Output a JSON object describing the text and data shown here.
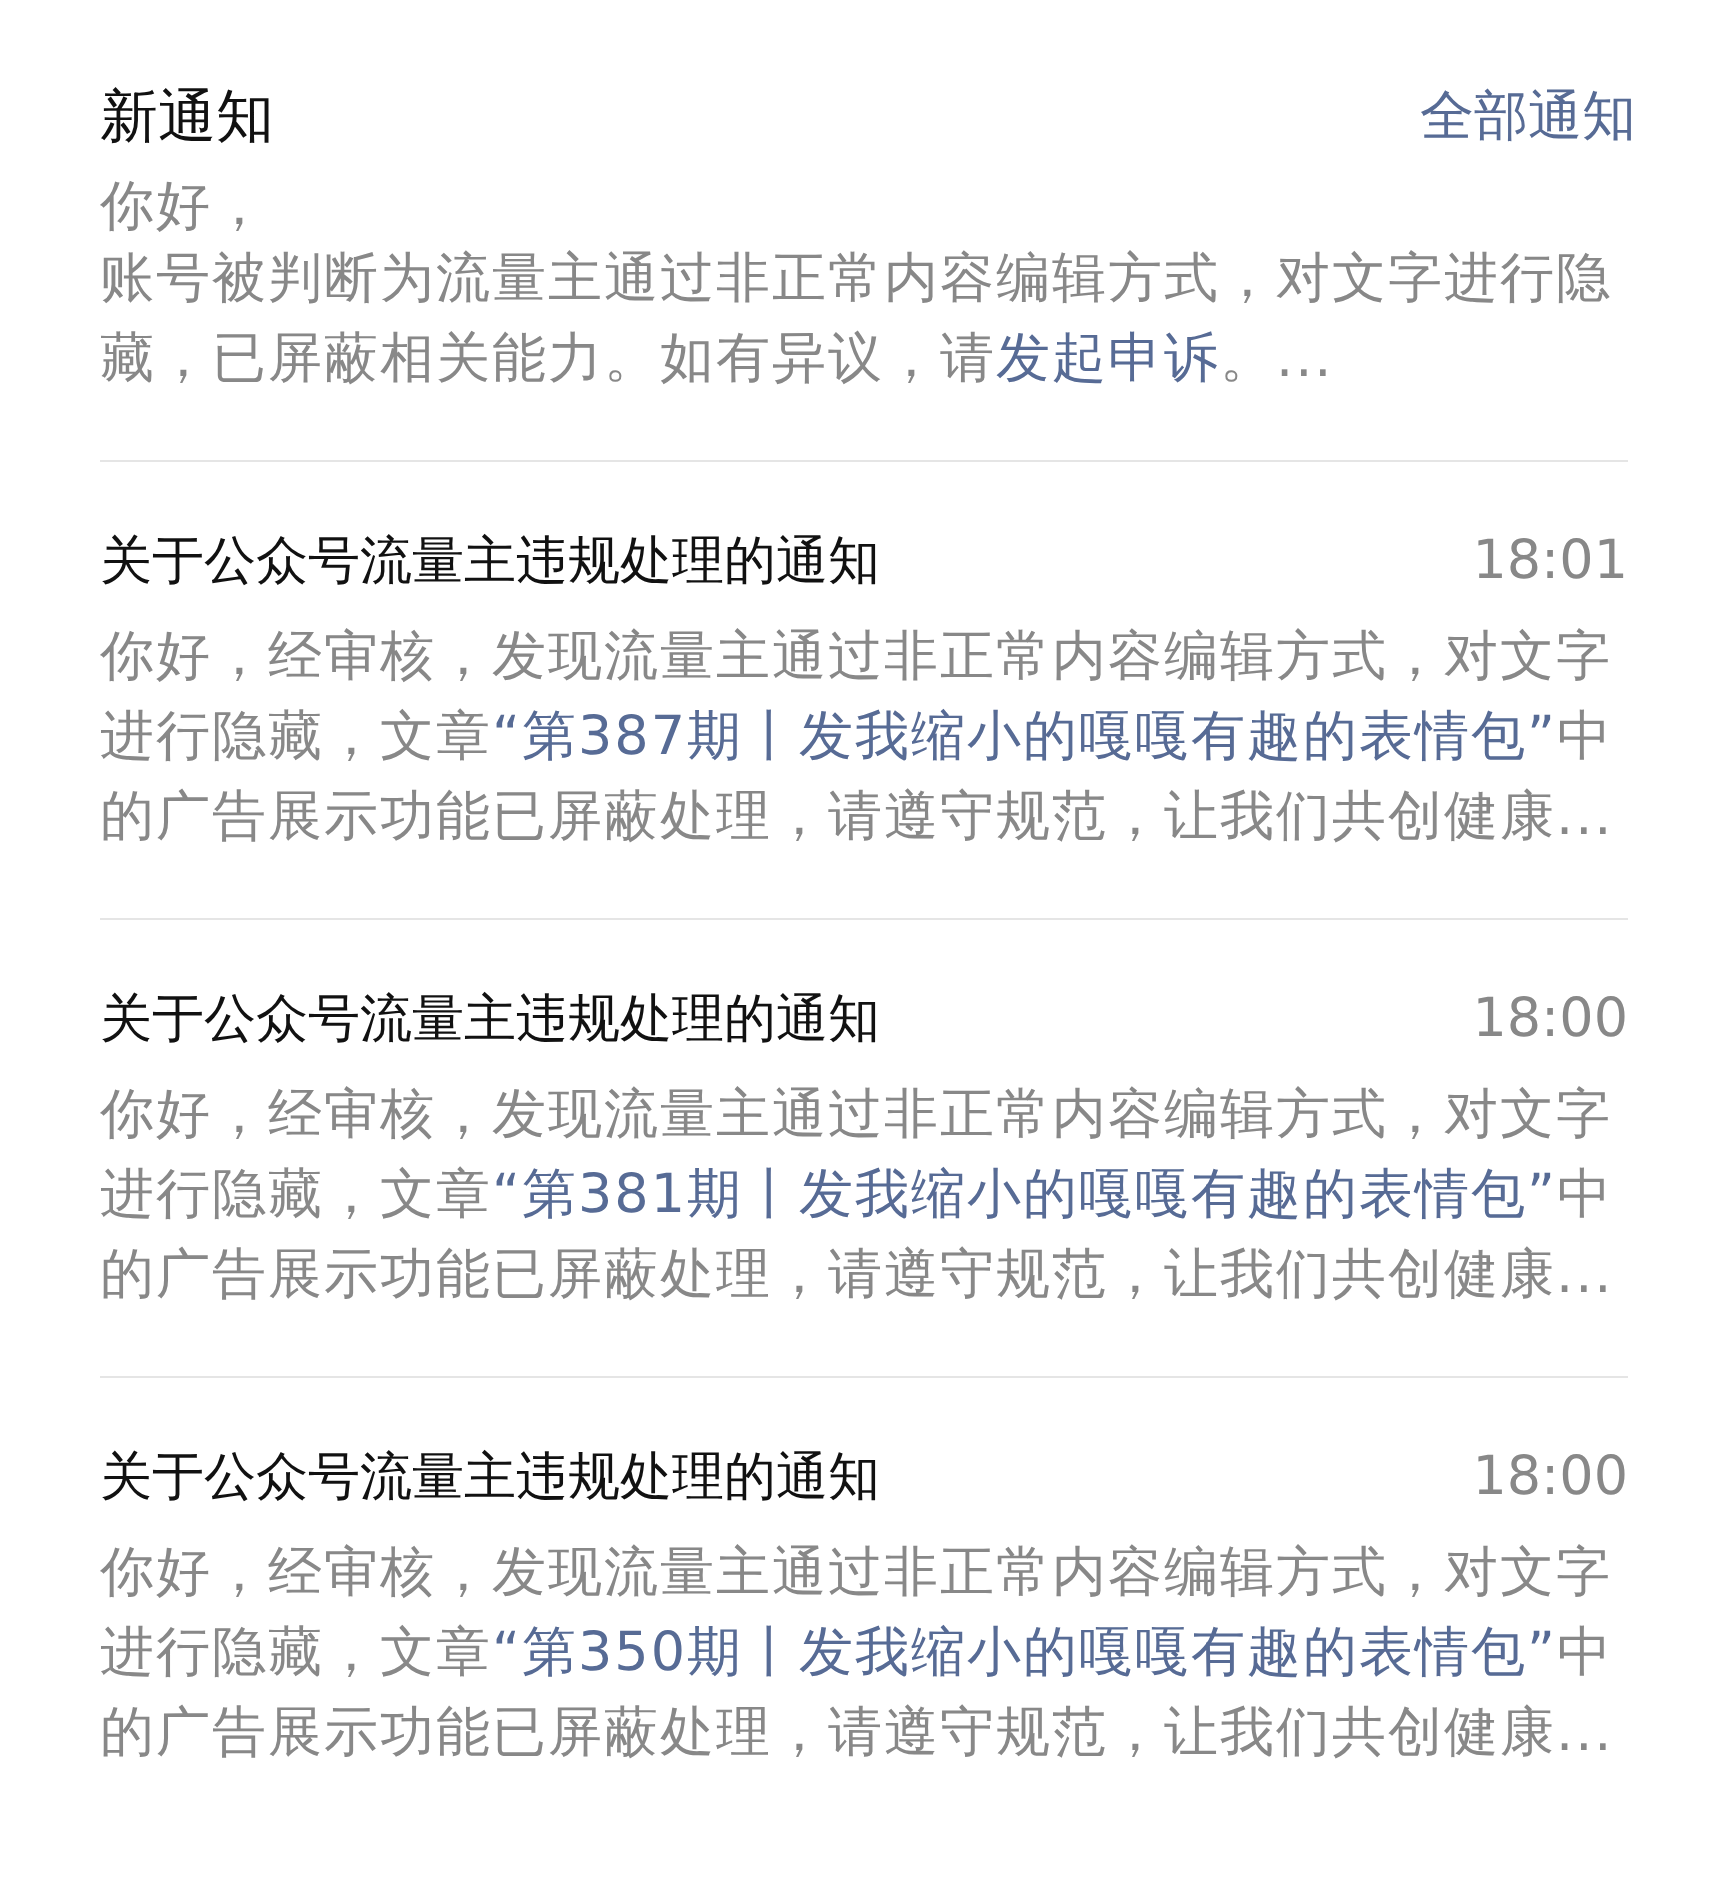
{
  "header": {
    "title": "新通知",
    "link": "全部通知"
  },
  "notices": [
    {
      "greeting": "你好，",
      "lines": [
        {
          "kind": "text",
          "text": "账号被判断为流量主通过非正常内容编辑方式，对文字进行隐藏，已屏蔽相关能力。如有异议，请"
        },
        {
          "kind": "link",
          "text": "发起申诉"
        },
        {
          "kind": "text",
          "text": "。..."
        }
      ]
    },
    {
      "title": "关于公众号流量主违规处理的通知",
      "time": "18:01",
      "lines": [
        {
          "kind": "text",
          "text": "你好，经审核，发现流量主通过非正常内容编辑方式，对文字进行隐藏，文章"
        },
        {
          "kind": "link",
          "text": "“第387期丨发我缩小的嘎嘎有趣的表情包”"
        },
        {
          "kind": "text",
          "text": "中的广告展示功能已屏蔽处理，请遵守规范，让我们共创健康..."
        }
      ]
    },
    {
      "title": "关于公众号流量主违规处理的通知",
      "time": "18:00",
      "lines": [
        {
          "kind": "text",
          "text": "你好，经审核，发现流量主通过非正常内容编辑方式，对文字进行隐藏，文章"
        },
        {
          "kind": "link",
          "text": "“第381期丨发我缩小的嘎嘎有趣的表情包”"
        },
        {
          "kind": "text",
          "text": "中的广告展示功能已屏蔽处理，请遵守规范，让我们共创健康..."
        }
      ]
    },
    {
      "title": "关于公众号流量主违规处理的通知",
      "time": "18:00",
      "lines": [
        {
          "kind": "text",
          "text": "你好，经审核，发现流量主通过非正常内容编辑方式，对文字进行隐藏，文章"
        },
        {
          "kind": "link",
          "text": "“第350期丨发我缩小的嘎嘎有趣的表情包”"
        },
        {
          "kind": "text",
          "text": "中的广告展示功能已屏蔽处理，请遵守规范，让我们共创健康..."
        }
      ]
    }
  ]
}
